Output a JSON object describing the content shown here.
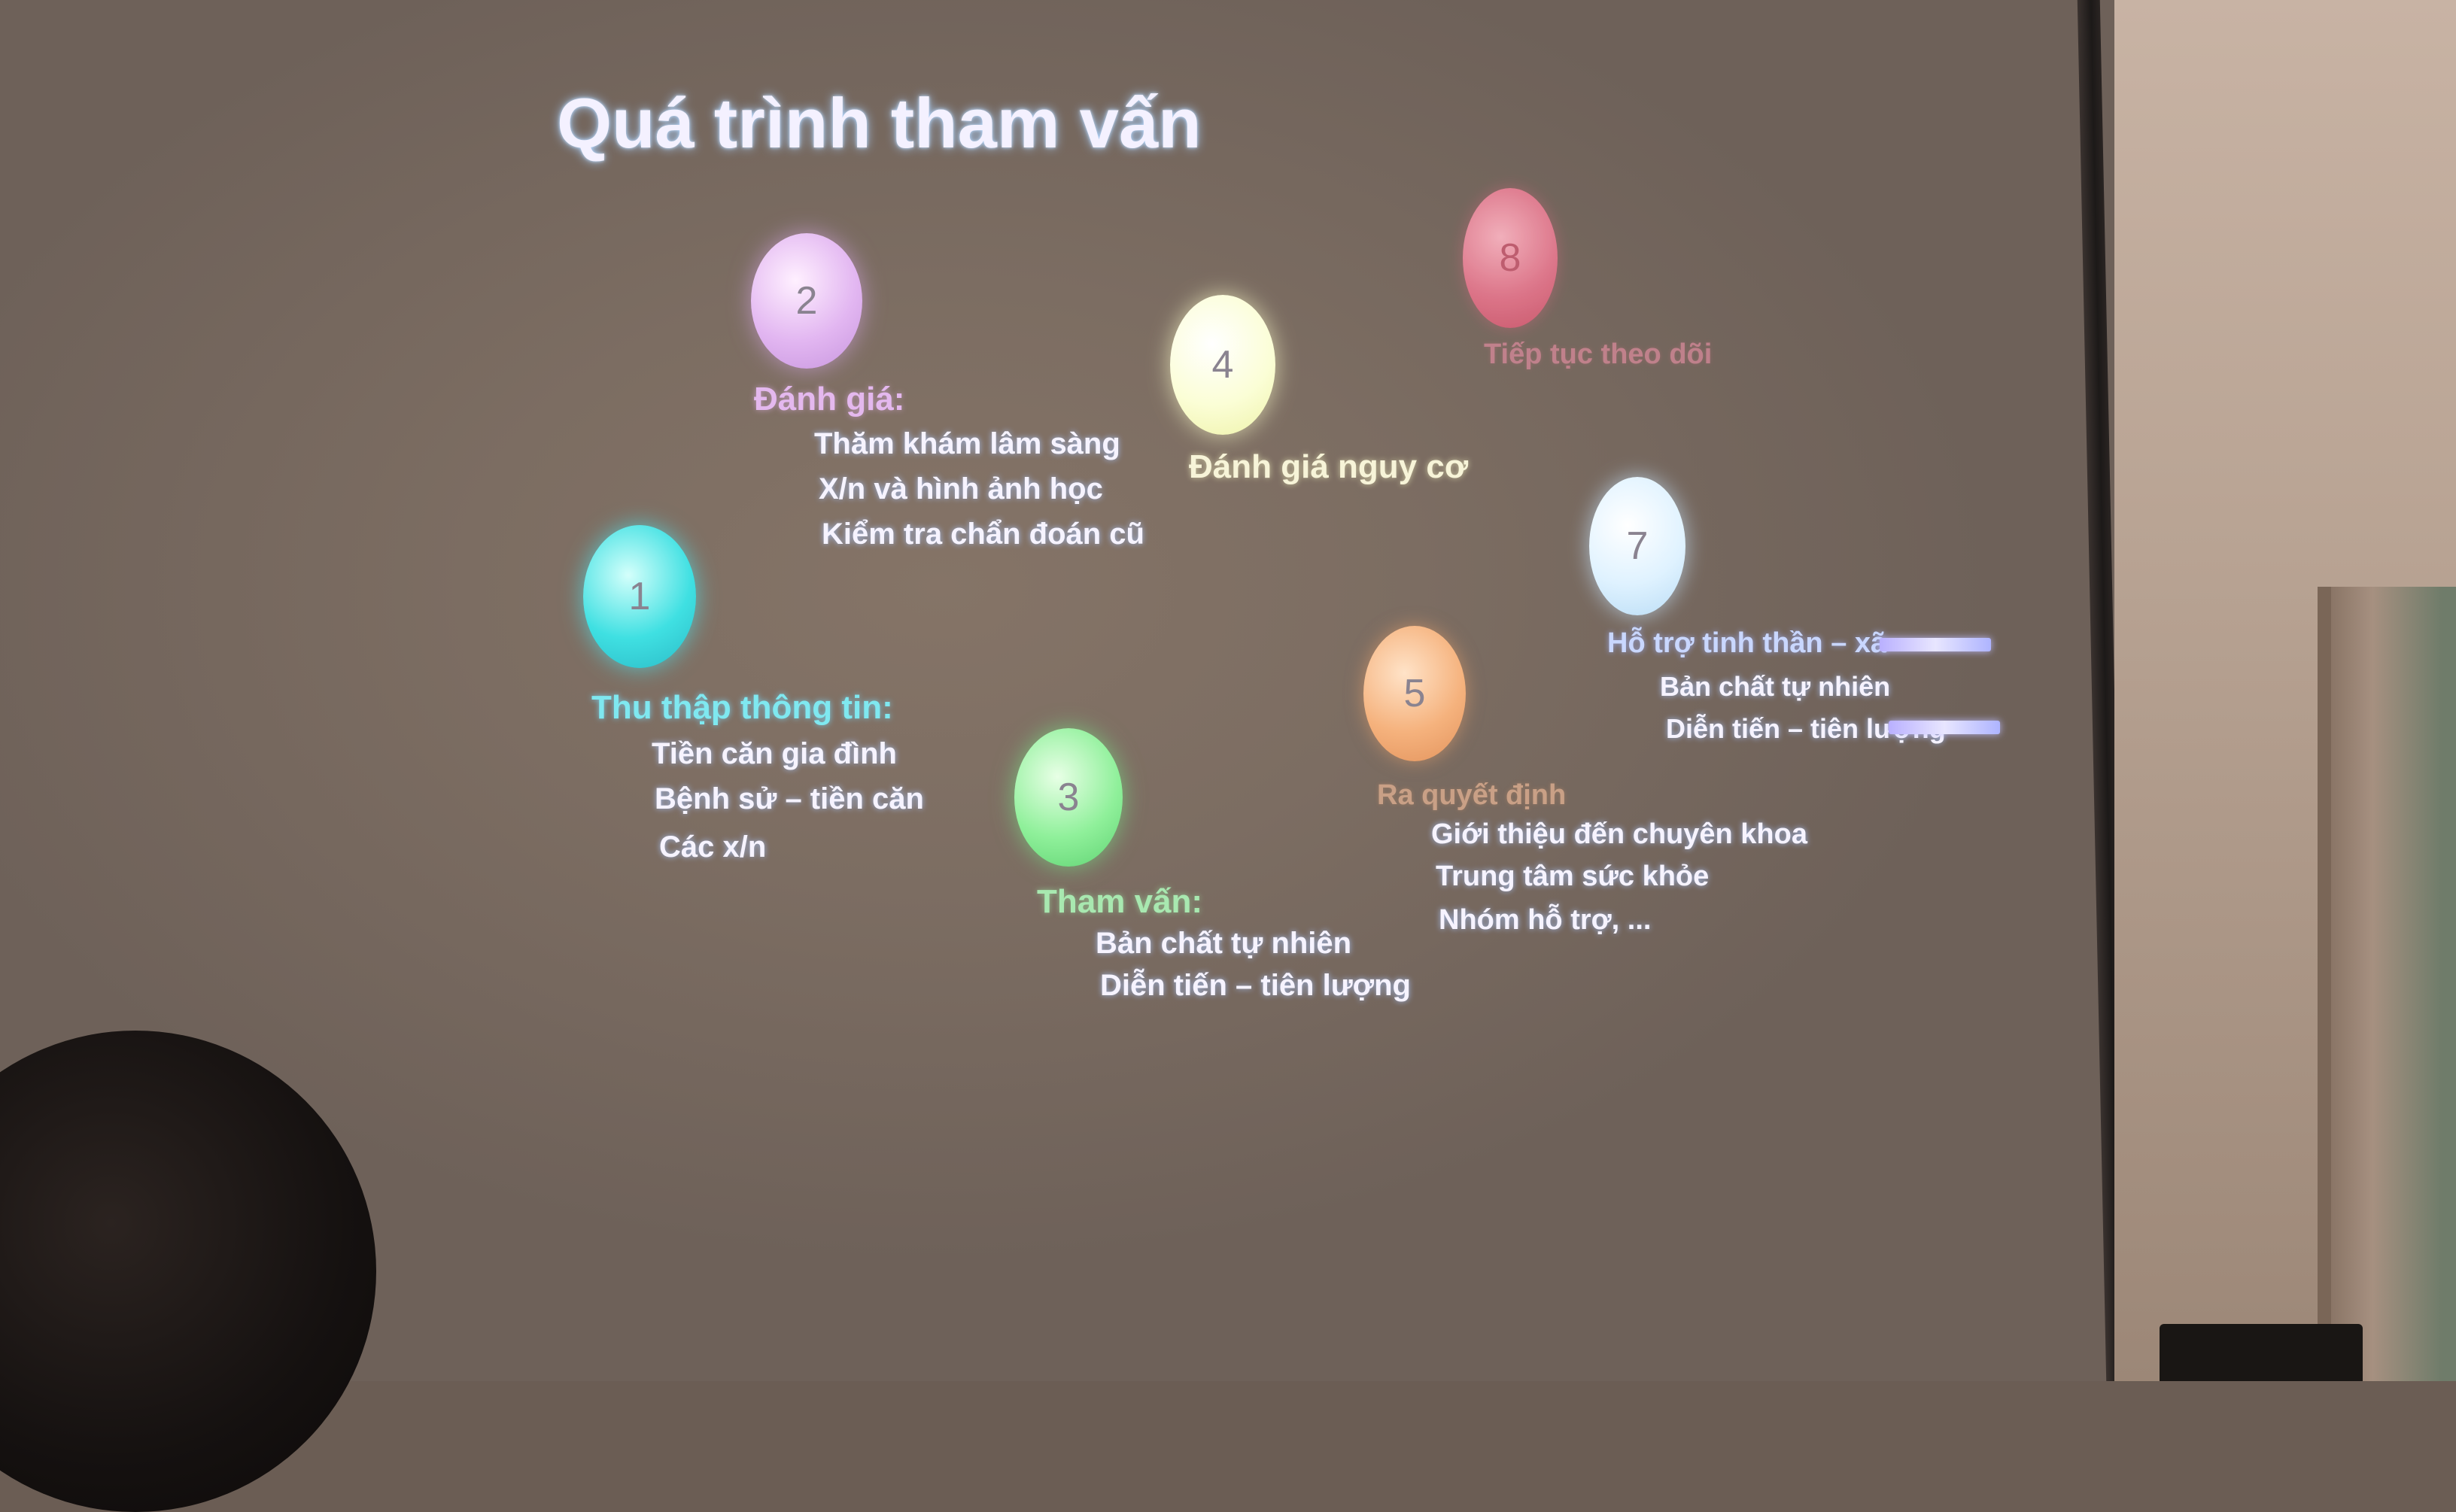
{
  "slide": {
    "title": "Quá trình tham vấn",
    "steps": [
      {
        "number": "1",
        "heading": "Thu thập thông tin:",
        "items": [
          "Tiền căn gia đình",
          "Bệnh sử – tiền căn",
          "Các x/n"
        ]
      },
      {
        "number": "2",
        "heading": "Đánh giá:",
        "items": [
          "Thăm khám lâm sàng",
          "X/n và hình ảnh học",
          "Kiểm tra chẩn đoán cũ"
        ]
      },
      {
        "number": "3",
        "heading": "Tham vấn:",
        "items": [
          "Bản chất tự nhiên",
          "Diễn tiến – tiên lượng"
        ]
      },
      {
        "number": "4",
        "heading": "Đánh giá nguy cơ",
        "items": []
      },
      {
        "number": "5",
        "heading": "Ra quyết định",
        "items": [
          "Giới thiệu đến chuyên khoa",
          "Trung tâm sức khỏe",
          "Nhóm hỗ trợ, ..."
        ]
      },
      {
        "number": "7",
        "heading": "Hỗ trợ tinh thần – xã",
        "items": [
          "Bản chất tự nhiên",
          "Diễn tiến – tiên lượng"
        ]
      },
      {
        "number": "8",
        "heading": "Tiếp tục theo dõi",
        "items": []
      }
    ]
  },
  "colors": {
    "step1": "#3fe0e2",
    "step2": "#e2b6f1",
    "step3": "#8ff09a",
    "step4": "#fbfed6",
    "step5": "#f5b27d",
    "step7": "#dff2ff",
    "step8": "#e8788f"
  }
}
